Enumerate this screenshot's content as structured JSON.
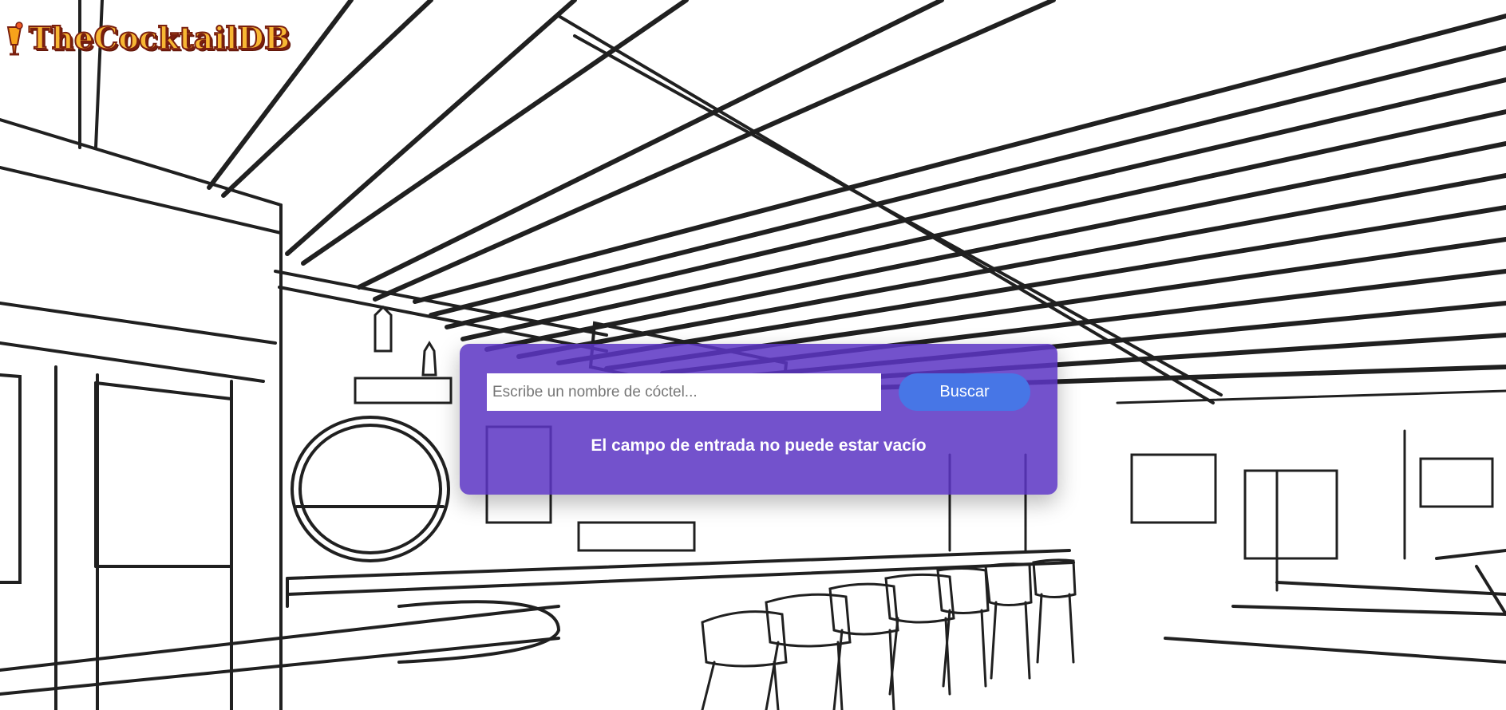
{
  "app": {
    "logo_text": "TheCocktailDB"
  },
  "search": {
    "placeholder": "Escribe un nombre de cóctel...",
    "value": "",
    "button_label": "Buscar",
    "error_message": "El campo de entrada no puede estar vacío"
  },
  "colors": {
    "panel": "#5c35c4",
    "button": "#4776e6",
    "logo_fill": "#f7b733",
    "logo_outline": "#7a1f0f"
  },
  "icons": {
    "logo": "cocktail-glass-icon"
  },
  "background": {
    "description_icon": "bar-line-drawing"
  }
}
